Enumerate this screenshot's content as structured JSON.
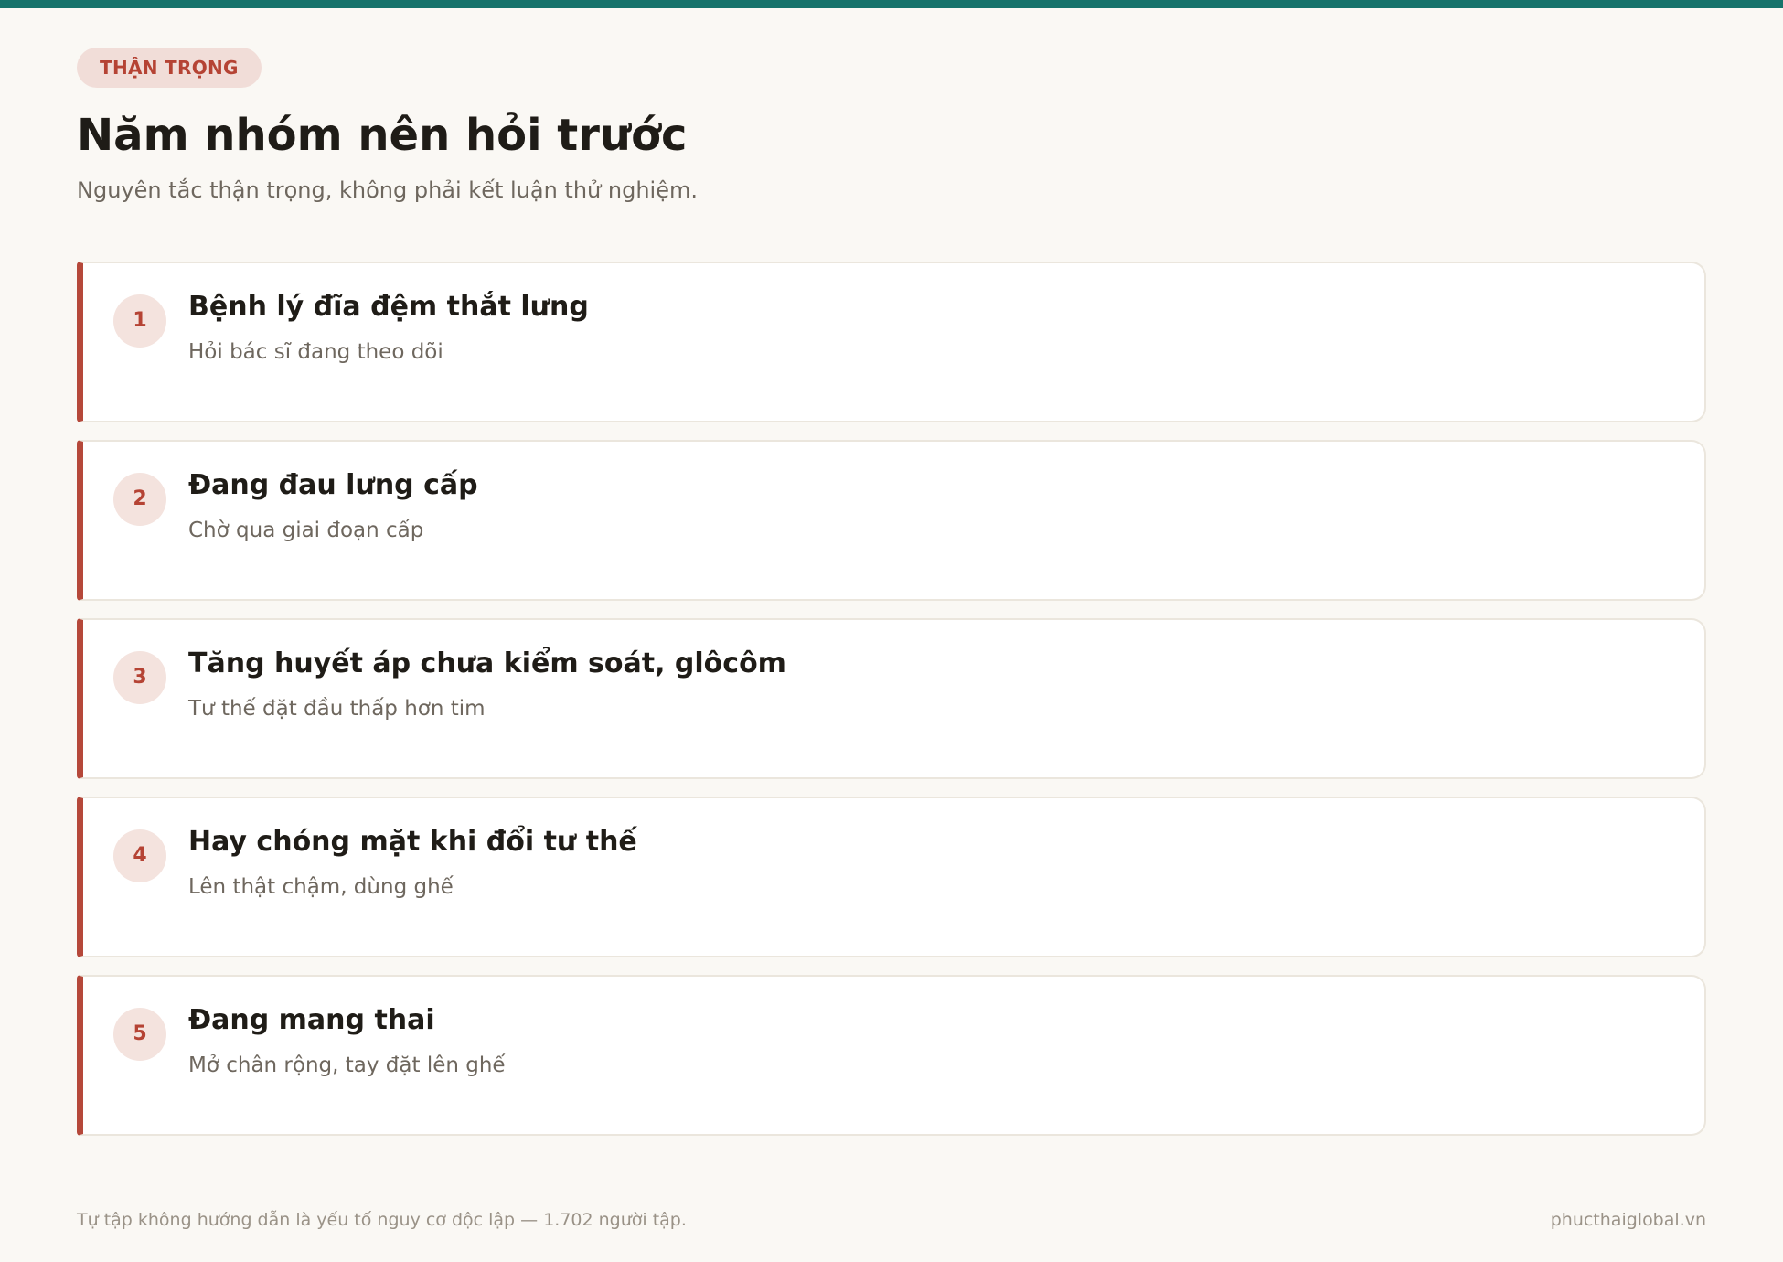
{
  "header": {
    "badge": "THẬN TRỌNG",
    "title": "Năm nhóm nên hỏi trước",
    "subtitle": "Nguyên tắc thận trọng, không phải kết luận thử nghiệm."
  },
  "items": [
    {
      "number": "1",
      "title": "Bệnh lý đĩa đệm thắt lưng",
      "note": "Hỏi bác sĩ đang theo dõi"
    },
    {
      "number": "2",
      "title": "Đang đau lưng cấp",
      "note": "Chờ qua giai đoạn cấp"
    },
    {
      "number": "3",
      "title": "Tăng huyết áp chưa kiểm soát, glôcôm",
      "note": "Tư thế đặt đầu thấp hơn tim"
    },
    {
      "number": "4",
      "title": "Hay chóng mặt khi đổi tư thế",
      "note": "Lên thật chậm, dùng ghế"
    },
    {
      "number": "5",
      "title": "Đang mang thai",
      "note": "Mở chân rộng, tay đặt lên ghế"
    }
  ],
  "footer": {
    "note": "Tự tập không hướng dẫn là yếu tố nguy cơ độc lập — 1.702 người tập.",
    "site": "phucthaiglobal.vn"
  },
  "colors": {
    "accent_top": "#16736b",
    "accent_red": "#b5483a",
    "badge_bg": "#f1ddd8",
    "background": "#faf8f4"
  }
}
